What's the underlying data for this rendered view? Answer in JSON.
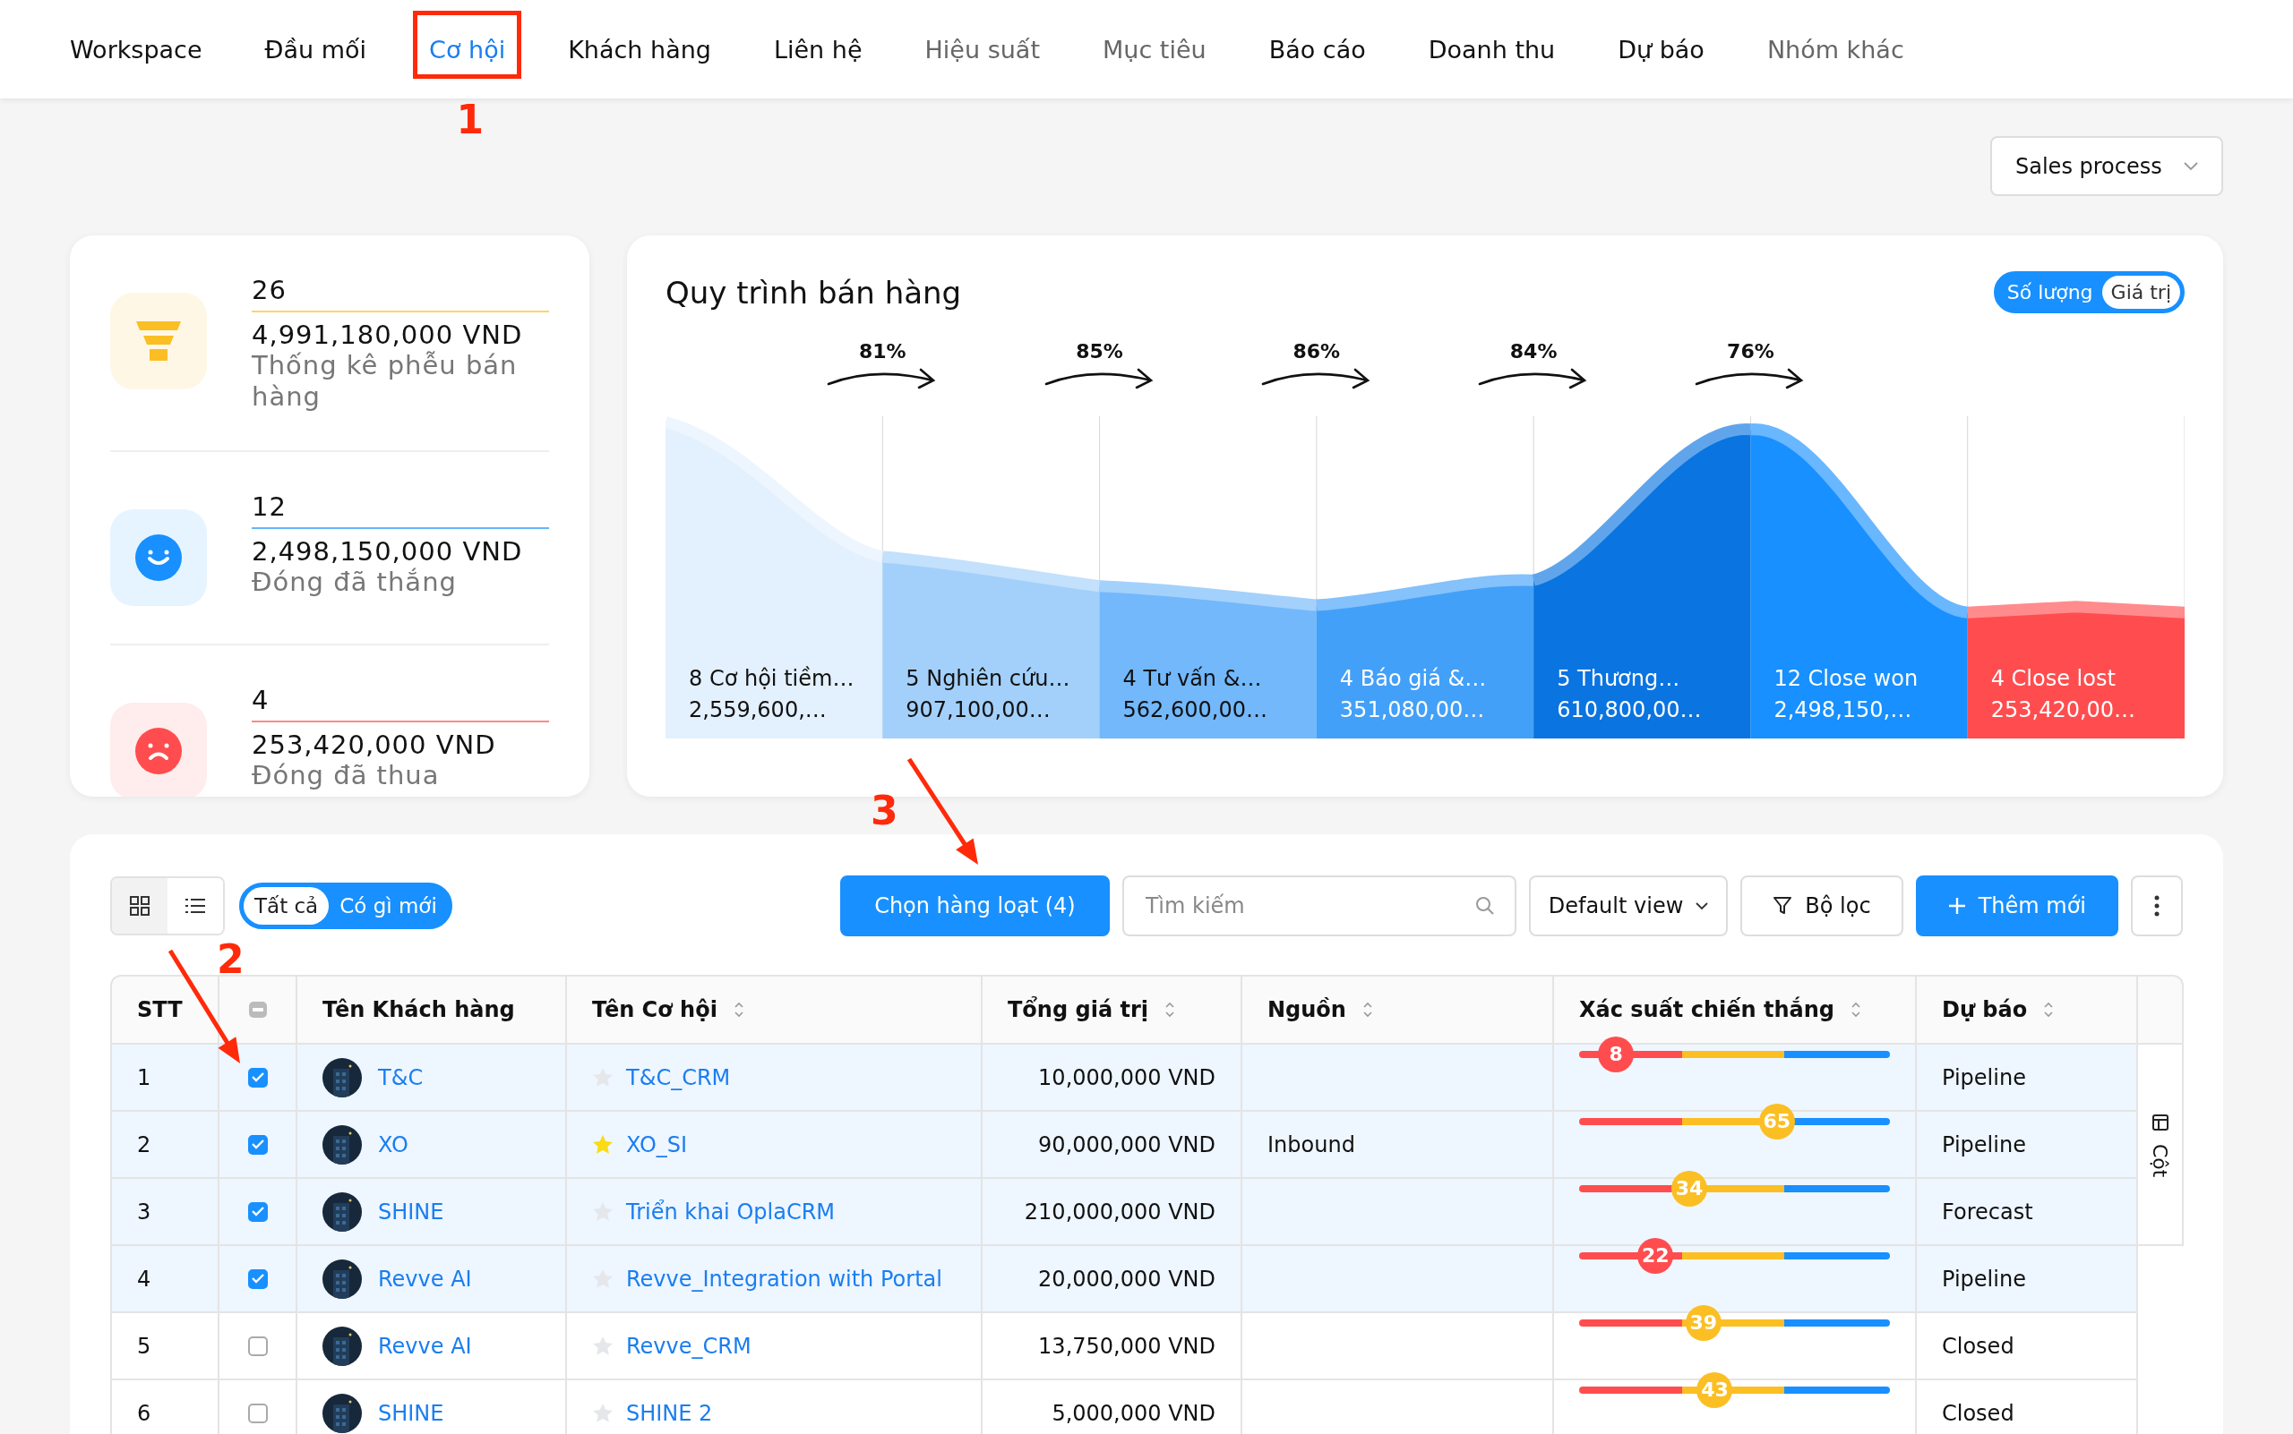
{
  "nav": {
    "tabs": [
      {
        "label": "Workspace",
        "selected": false,
        "dimmed": false
      },
      {
        "label": "Đầu mối",
        "selected": false,
        "dimmed": false
      },
      {
        "label": "Cơ hội",
        "selected": true,
        "dimmed": false
      },
      {
        "label": "Khách hàng",
        "selected": false,
        "dimmed": false
      },
      {
        "label": "Liên hệ",
        "selected": false,
        "dimmed": false
      },
      {
        "label": "Hiệu suất",
        "selected": false,
        "dimmed": true
      },
      {
        "label": "Mục tiêu",
        "selected": false,
        "dimmed": true
      },
      {
        "label": "Báo cáo",
        "selected": false,
        "dimmed": false
      },
      {
        "label": "Doanh thu",
        "selected": false,
        "dimmed": false
      },
      {
        "label": "Dự báo",
        "selected": false,
        "dimmed": false
      },
      {
        "label": "Nhóm khác",
        "selected": false,
        "dimmed": true
      }
    ]
  },
  "process_select": {
    "value": "Sales process"
  },
  "summary": [
    {
      "kind": "funnel",
      "color": "#fbbf24",
      "count": "26",
      "amount": "4,991,180,000 VND",
      "label": "Thống kê phễu bán hàng"
    },
    {
      "kind": "happy",
      "color": "#1890ff",
      "count": "12",
      "amount": "2,498,150,000 VND",
      "label": "Đóng đã thắng"
    },
    {
      "kind": "sad",
      "color": "#ff4d4f",
      "count": "4",
      "amount": "253,420,000 VND",
      "label": "Đóng đã thua"
    }
  ],
  "funnel": {
    "title": "Quy trình bán hàng",
    "toggle": [
      {
        "label": "Số lượng",
        "selected": false
      },
      {
        "label": "Giá trị",
        "selected": true
      }
    ],
    "conversions": [
      "81%",
      "85%",
      "86%",
      "84%",
      "76%"
    ],
    "stages": [
      {
        "label": "8 Cơ hội tiềm…",
        "value": "2,559,600,…",
        "color": "#e3f0fd"
      },
      {
        "label": "5 Nghiên cứu…",
        "value": "907,100,00…",
        "color": "#a3d0fb"
      },
      {
        "label": "4 Tư vấn &…",
        "value": "562,600,00…",
        "color": "#72b8fb"
      },
      {
        "label": "4 Báo giá &…",
        "value": "351,080,00…",
        "color": "#43a0f8"
      },
      {
        "label": "5 Thương…",
        "value": "610,800,00…",
        "color": "#0a74e0"
      },
      {
        "label": "12 Close won",
        "value": "2,498,150,…",
        "color": "#1890ff"
      },
      {
        "label": "4 Close lost",
        "value": "253,420,00…",
        "color": "#ff4d4f"
      }
    ]
  },
  "toolbar": {
    "views": [
      {
        "kind": "grid",
        "selected": false
      },
      {
        "kind": "list",
        "selected": true
      }
    ],
    "filters": [
      {
        "label": "Tất cả",
        "selected": true
      },
      {
        "label": "Có gì mới",
        "selected": false
      }
    ],
    "bulk_button": "Chọn hàng loạt (4)",
    "search": {
      "placeholder": "Tìm kiếm"
    },
    "view_select": "Default view",
    "filter_button": "Bộ lọc",
    "add_button": "Thêm mới"
  },
  "table": {
    "columns": [
      {
        "kind": "text",
        "label": "STT",
        "sortable": false
      },
      {
        "kind": "select",
        "sortable": false
      },
      {
        "kind": "text",
        "label": "Tên Khách hàng",
        "sortable": false
      },
      {
        "kind": "text",
        "label": "Tên Cơ hội",
        "sortable": true
      },
      {
        "kind": "text",
        "label": "Tổng giá trị",
        "sortable": true
      },
      {
        "kind": "text",
        "label": "Nguồn",
        "sortable": true
      },
      {
        "kind": "text",
        "label": "Xác suất chiến thắng",
        "sortable": true
      },
      {
        "kind": "text",
        "label": "Dự báo",
        "sortable": true
      }
    ],
    "column_panel": "Cột",
    "rows": [
      {
        "stt": "1",
        "checked": true,
        "customer": "T&C",
        "starred": false,
        "opportunity": "T&C_CRM",
        "total": "10,000,000 VND",
        "probability": {
          "level": 0.08,
          "reading": "8"
        },
        "forecast": "Pipeline"
      },
      {
        "stt": "2",
        "checked": true,
        "customer": "XO",
        "starred": true,
        "opportunity": "XO_SI",
        "total": "90,000,000 VND",
        "source": "Inbound",
        "probability": {
          "level": 0.65,
          "reading": "65"
        },
        "forecast": "Pipeline"
      },
      {
        "stt": "3",
        "checked": true,
        "customer": "SHINE",
        "starred": false,
        "opportunity": "Triển khai OplaCRM",
        "total": "210,000,000 VND",
        "probability": {
          "level": 0.34,
          "reading": "34"
        },
        "forecast": "Forecast"
      },
      {
        "stt": "4",
        "checked": true,
        "customer": "Revve AI",
        "starred": false,
        "opportunity": "Revve_Integration with Portal",
        "total": "20,000,000 VND",
        "probability": {
          "level": 0.22,
          "reading": "22"
        },
        "forecast": "Pipeline"
      },
      {
        "stt": "5",
        "checked": false,
        "customer": "Revve AI",
        "starred": false,
        "opportunity": "Revve_CRM",
        "total": "13,750,000 VND",
        "probability": {
          "level": 0.39,
          "reading": "39"
        },
        "forecast": "Closed"
      },
      {
        "stt": "6",
        "checked": false,
        "customer": "SHINE",
        "starred": false,
        "opportunity": "SHINE 2",
        "total": "5,000,000 VND",
        "probability": {
          "level": 0.43,
          "reading": "43"
        },
        "forecast": "Closed"
      }
    ]
  },
  "annotations": [
    {
      "label": "1",
      "kind": "frame"
    },
    {
      "label": "2",
      "kind": "arrow"
    },
    {
      "label": "3",
      "kind": "arrow"
    }
  ]
}
